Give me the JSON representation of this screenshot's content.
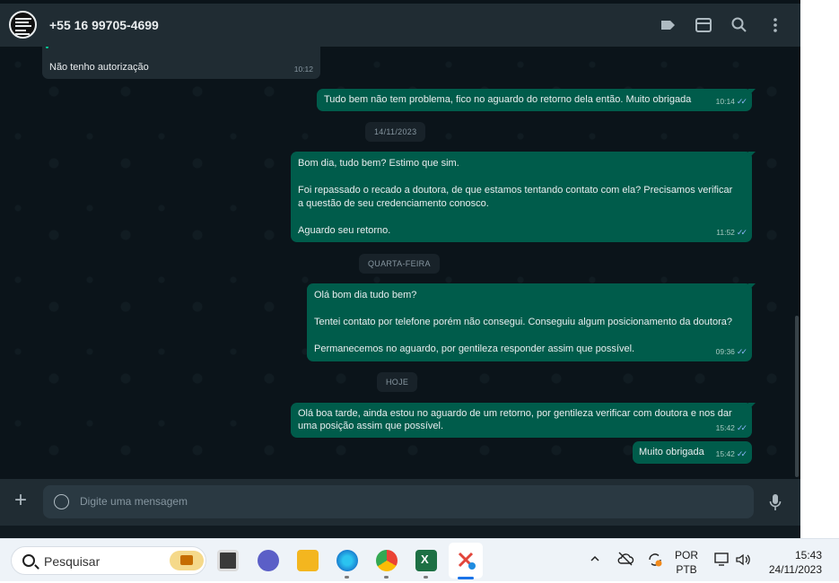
{
  "header": {
    "contact": "+55 16 99705-4699"
  },
  "messages": {
    "m1": {
      "text": "Não tenho autorização",
      "time": "10:12"
    },
    "m2": {
      "text": "Tudo bem não tem problema, fico no aguardo do retorno dela então. Muito obrigada",
      "time": "10:14"
    },
    "m3": {
      "line1": "Bom dia, tudo bem? Estimo que sim.",
      "line2": "Foi repassado o recado a doutora, de que estamos tentando contato com ela? Precisamos verificar",
      "line3": "a questão de seu credenciamento conosco.",
      "line4": "Aguardo seu retorno.",
      "time": "11:52"
    },
    "m4": {
      "line1": "Olá bom dia tudo bem?",
      "line2": "Tentei contato por telefone porém não consegui. Conseguiu algum posicionamento da doutora?",
      "line3": "Permanecemos no aguardo, por gentileza responder assim que possível.",
      "time": "09:36"
    },
    "m5": {
      "line1": "Olá boa tarde, ainda estou no aguardo de um retorno, por gentileza verificar com doutora e nos dar",
      "line2": "uma posição assim que possível.",
      "time": "15:42"
    },
    "m6": {
      "text": "Muito obrigada",
      "time": "15:42"
    }
  },
  "dates": {
    "d1": "14/11/2023",
    "d2": "QUARTA-FEIRA",
    "d3": "HOJE"
  },
  "composer": {
    "placeholder": "Digite uma mensagem"
  },
  "taskbar": {
    "search_label": "Pesquisar",
    "lang_top": "POR",
    "lang_bottom": "PTB",
    "time": "15:43",
    "date": "24/11/2023"
  },
  "colors": {
    "outgoing": "#005c4b",
    "incoming": "#202c33",
    "background": "#0b141a",
    "read_ticks": "#53bdeb"
  }
}
